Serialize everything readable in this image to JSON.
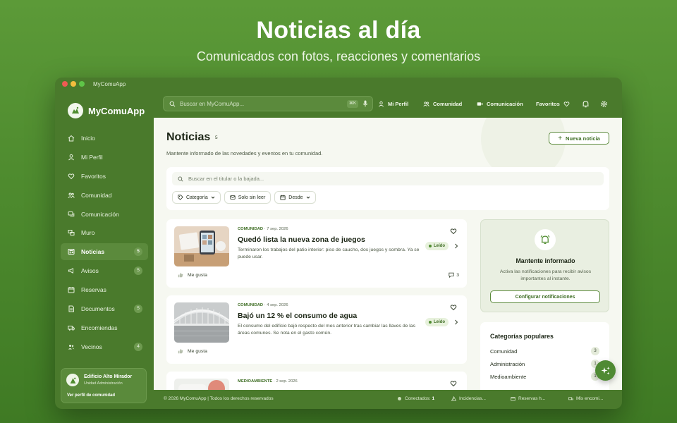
{
  "hero": {
    "title": "Noticias al día",
    "subtitle": "Comunicados con fotos, reacciones y comentarios"
  },
  "window": {
    "title": "MyComuApp"
  },
  "sidebar": {
    "brand": "MyComuApp",
    "items": [
      {
        "label": "Inicio",
        "icon": "home-icon",
        "badge": ""
      },
      {
        "label": "Mi Perfil",
        "icon": "user-icon",
        "badge": ""
      },
      {
        "label": "Favoritos",
        "icon": "heart-icon",
        "badge": ""
      },
      {
        "label": "Comunidad",
        "icon": "users-icon",
        "badge": ""
      },
      {
        "label": "Comunicación",
        "icon": "chat-icon",
        "badge": ""
      },
      {
        "label": "Muro",
        "icon": "wall-icon",
        "badge": ""
      },
      {
        "label": "Noticias",
        "icon": "newspaper-icon",
        "badge": "5",
        "active": true
      },
      {
        "label": "Avisos",
        "icon": "megaphone-icon",
        "badge": "5"
      },
      {
        "label": "Reservas",
        "icon": "calendar-icon",
        "badge": ""
      },
      {
        "label": "Documentos",
        "icon": "document-icon",
        "badge": "5"
      },
      {
        "label": "Encomiendas",
        "icon": "truck-icon",
        "badge": ""
      },
      {
        "label": "Vecinos",
        "icon": "neighbors-icon",
        "badge": "4"
      }
    ],
    "community": {
      "name": "Edificio Alto Mirador",
      "role": "Unidad Administración",
      "link": "Ver perfil de comunidad"
    }
  },
  "topbar": {
    "search_placeholder": "Buscar en MyComuApp...",
    "shortcut": "⌘K",
    "nav": [
      "Mi Perfil",
      "Comunidad",
      "Comunicación",
      "Favoritos"
    ]
  },
  "main": {
    "title": "Noticias",
    "count": "5",
    "description": "Mantente informado de las novedades y eventos en tu comunidad.",
    "new_button": "Nueva noticia",
    "filter_placeholder": "Buscar en el titular o la bajada...",
    "chips": [
      "Categoría",
      "Solo sin leer",
      "Desde"
    ],
    "news": [
      {
        "category": "COMUNIDAD",
        "date": "· 7 sep. 2026",
        "title": "Quedó lista la nueva zona de juegos",
        "excerpt": "Terminaron los trabajos del patio interior: piso de caucho, dos juegos y sombra. Ya se puede usar.",
        "badge": "Leído",
        "like": "Me gusta",
        "comments": "3"
      },
      {
        "category": "COMUNIDAD",
        "date": "· 4 sep. 2026",
        "title": "Bajó un 12 % el consumo de agua",
        "excerpt": "El consumo del edificio bajó respecto del mes anterior tras cambiar las llaves de las áreas comunes. Se nota en el gasto común.",
        "badge": "Leído",
        "like": "Me gusta",
        "comments": ""
      },
      {
        "category": "MEDIOAMBIENTE",
        "date": "· 2 sep. 2026",
        "title": "",
        "excerpt": "",
        "badge": "",
        "like": "",
        "comments": ""
      }
    ],
    "notify": {
      "title": "Mantente informado",
      "description": "Activa las notificaciones para recibir avisos importantes al instante.",
      "button": "Configurar notificaciones"
    },
    "popular": {
      "title": "Categorías populares",
      "items": [
        {
          "name": "Comunidad",
          "count": "3"
        },
        {
          "name": "Administración",
          "count": "1"
        },
        {
          "name": "Medioambiente",
          "count": "1"
        }
      ]
    }
  },
  "footer": {
    "copyright": "© 2026 MyComuApp | Todos los derechos reservados",
    "connected_label": "Conectados:",
    "connected_value": "1",
    "incidents": "Incidencias...",
    "reservations": "Reservas h...",
    "parcels": "Mis encomi..."
  },
  "colors": {
    "brand_green": "#4f8c2f",
    "sidebar_green": "#4a7a2c",
    "accent_text": "#3f6e25"
  }
}
